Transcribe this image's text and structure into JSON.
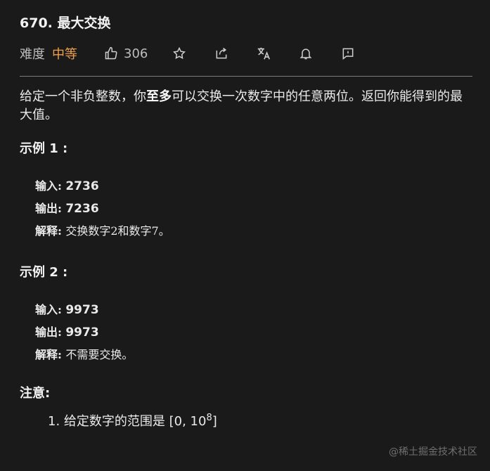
{
  "problem": {
    "title": "670. 最大交换",
    "difficulty_label": "难度",
    "difficulty": "中等",
    "likes": "306",
    "colors": {
      "difficulty": "#f0a04b",
      "background": "#1a1a1a"
    },
    "icons": [
      "thumbs-up-icon",
      "star-icon",
      "share-icon",
      "translate-icon",
      "bell-icon",
      "feedback-icon"
    ]
  },
  "description": {
    "part1": "给定一个非负整数，你",
    "bold": "至多",
    "part2": "可以交换一次数字中的任意两位。返回你能得到的最大值。"
  },
  "examples": [
    {
      "title": "示例 1 :",
      "input_label": "输入:",
      "input": "2736",
      "output_label": "输出:",
      "output": "7236",
      "explain_label": "解释:",
      "explain": "交换数字2和数字7。"
    },
    {
      "title": "示例 2 :",
      "input_label": "输入:",
      "input": "9973",
      "output_label": "输出:",
      "output": "9973",
      "explain_label": "解释:",
      "explain": "不需要交换。"
    }
  ],
  "notes": {
    "title": "注意:",
    "item1_number": "1.",
    "item1_text": "给定数字的范围是 [0, 10",
    "item1_exponent": "8",
    "item1_end": "]"
  },
  "watermark": "@稀土掘金技术社区"
}
